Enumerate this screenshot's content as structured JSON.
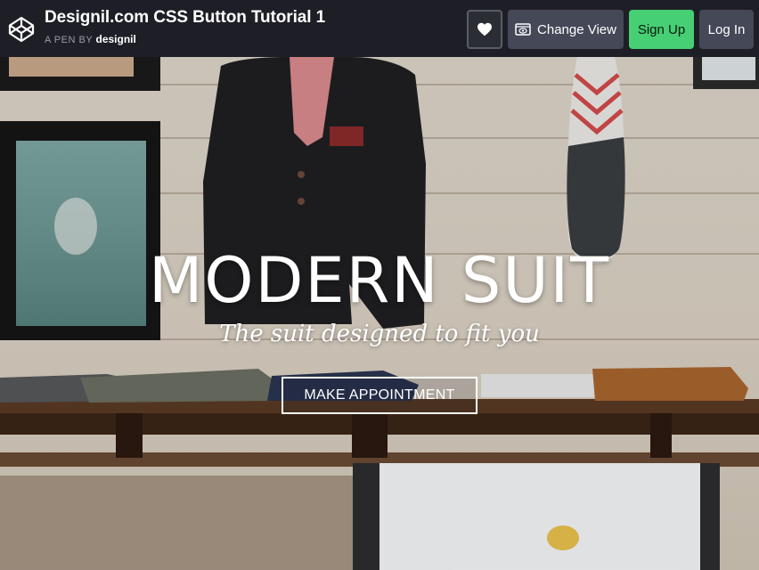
{
  "header": {
    "title": "Designil.com CSS Button Tutorial 1",
    "byline_prefix": "A PEN BY",
    "author": "designil",
    "change_view_label": "Change View",
    "signup_label": "Sign Up",
    "login_label": "Log In"
  },
  "hero": {
    "headline": "MODERN SUIT",
    "tagline": "The suit designed to fit you",
    "cta_label": "MAKE APPOINTMENT"
  },
  "colors": {
    "topbar_bg": "#1e1f26",
    "signup_green": "#47cf73",
    "button_grey": "#444857"
  },
  "icons": [
    "codepen-logo-icon",
    "heart-icon",
    "eye-icon"
  ]
}
